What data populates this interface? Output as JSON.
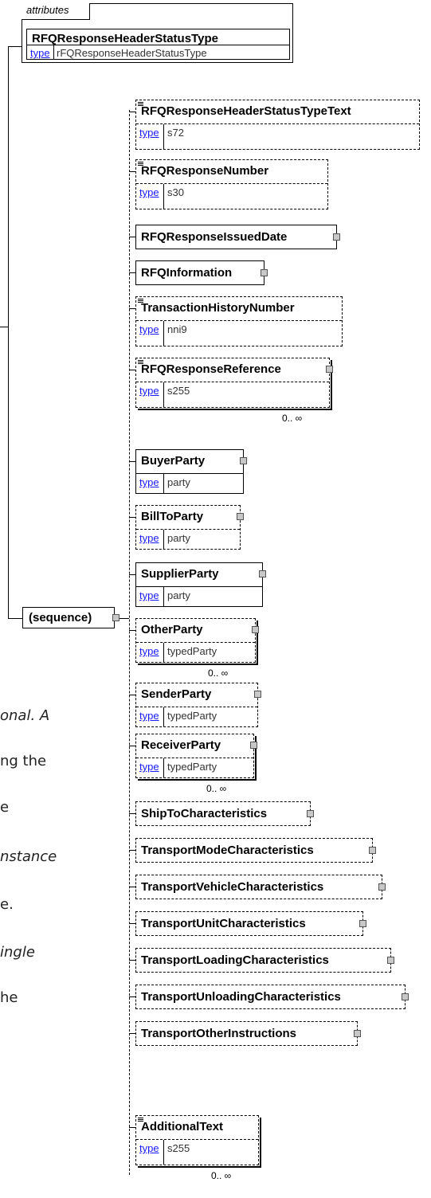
{
  "attributes": {
    "header": "attributes",
    "name": "RFQResponseHeaderStatusType",
    "type_label": "type",
    "type_value": "rFQResponseHeaderStatusType"
  },
  "sequence": {
    "label": "(sequence)"
  },
  "elements": [
    {
      "name": "RFQResponseHeaderStatusTypeText",
      "type_label": "type",
      "type_value": "s72",
      "optional": true,
      "doc": true
    },
    {
      "name": "RFQResponseNumber",
      "type_label": "type",
      "type_value": "s30",
      "optional": true,
      "doc": true
    },
    {
      "name": "RFQResponseIssuedDate",
      "optional": false
    },
    {
      "name": "RFQInformation",
      "optional": false
    },
    {
      "name": "TransactionHistoryNumber",
      "type_label": "type",
      "type_value": "nni9",
      "optional": true,
      "doc": true
    },
    {
      "name": "RFQResponseReference",
      "type_label": "type",
      "type_value": "s255",
      "optional": true,
      "doc": true,
      "cardinality": "0.. ∞"
    },
    {
      "name": "BuyerParty",
      "type_label": "type",
      "type_value": "party",
      "optional": false
    },
    {
      "name": "BillToParty",
      "type_label": "type",
      "type_value": "party",
      "optional": true
    },
    {
      "name": "SupplierParty",
      "type_label": "type",
      "type_value": "party",
      "optional": false
    },
    {
      "name": "OtherParty",
      "type_label": "type",
      "type_value": "typedParty",
      "optional": true,
      "cardinality": "0.. ∞"
    },
    {
      "name": "SenderParty",
      "type_label": "type",
      "type_value": "typedParty",
      "optional": true
    },
    {
      "name": "ReceiverParty",
      "type_label": "type",
      "type_value": "typedParty",
      "optional": true,
      "cardinality": "0.. ∞"
    },
    {
      "name": "ShipToCharacteristics",
      "optional": true
    },
    {
      "name": "TransportModeCharacteristics",
      "optional": true
    },
    {
      "name": "TransportVehicleCharacteristics",
      "optional": true
    },
    {
      "name": "TransportUnitCharacteristics",
      "optional": true
    },
    {
      "name": "TransportLoadingCharacteristics",
      "optional": true
    },
    {
      "name": "TransportUnloadingCharacteristics",
      "optional": true
    },
    {
      "name": "TransportOtherInstructions",
      "optional": true
    },
    {
      "name": "AdditionalText",
      "type_label": "type",
      "type_value": "s255",
      "optional": true,
      "doc": true,
      "cardinality": "0.. ∞"
    }
  ],
  "side_text": [
    "onal. A",
    "ng the",
    "e",
    "nstance",
    "e.",
    "ingle",
    "he"
  ]
}
